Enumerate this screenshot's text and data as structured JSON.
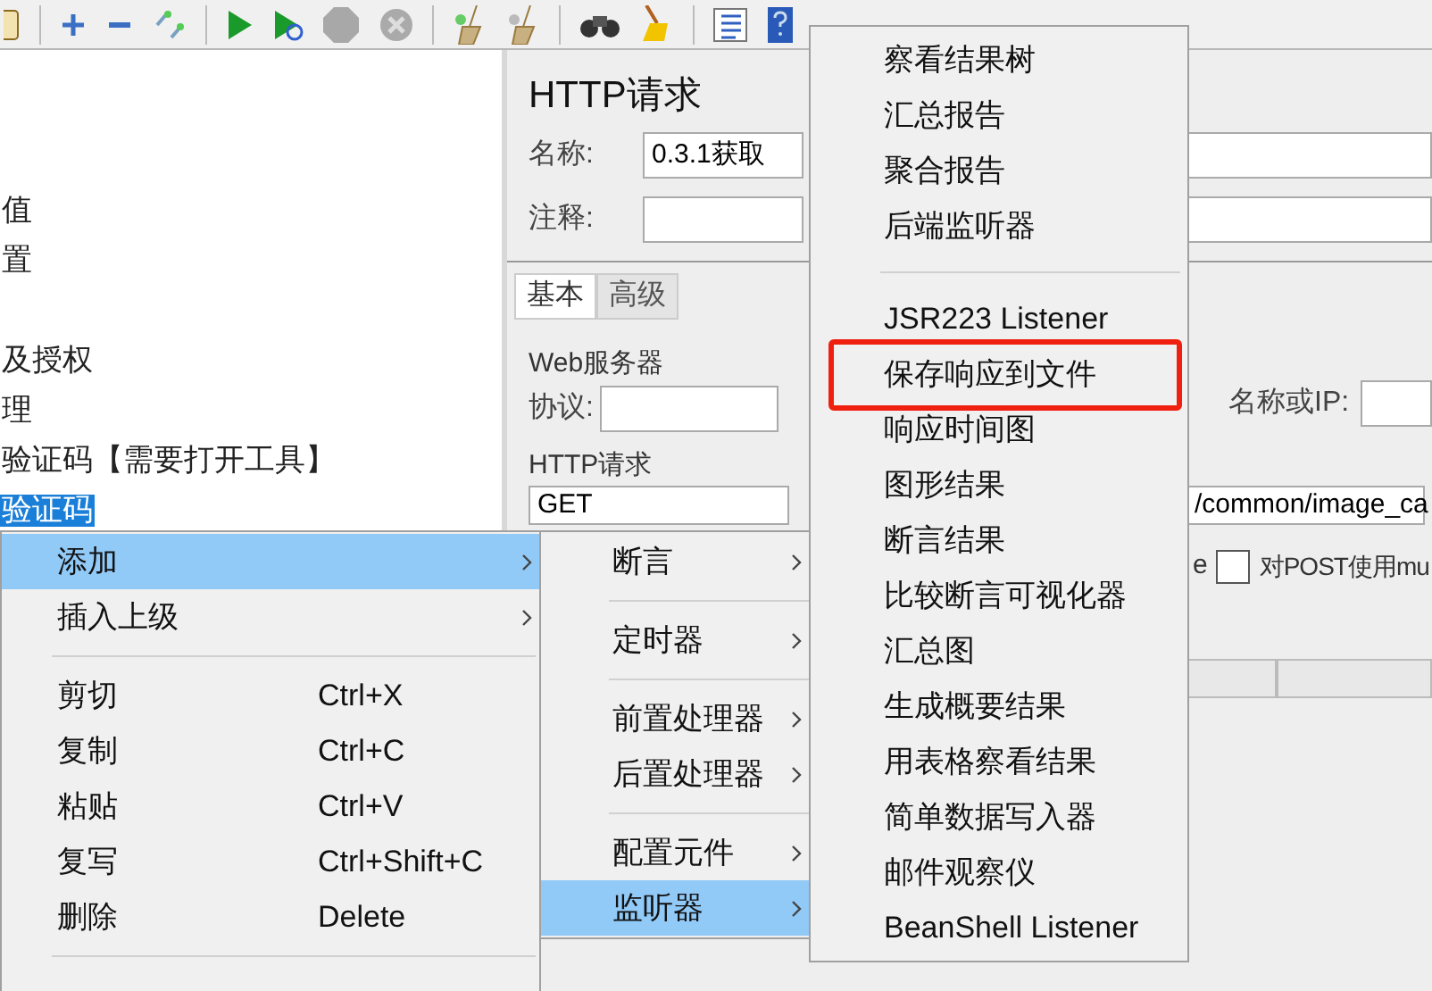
{
  "tree": {
    "items": [
      {
        "label": "值",
        "selected": false
      },
      {
        "label": "置",
        "selected": false
      },
      {
        "label": "及授权",
        "selected": false
      },
      {
        "label": "理",
        "selected": false
      },
      {
        "label": "验证码【需要打开工具】",
        "selected": false
      },
      {
        "label": "验证码",
        "selected": true
      }
    ]
  },
  "editor": {
    "title": "HTTP请求",
    "name_label": "名称:",
    "name_value": "0.3.1获取",
    "comment_label": "注释:",
    "tabs": [
      {
        "label": "基本",
        "selected": true
      },
      {
        "label": "高级",
        "selected": false
      }
    ],
    "web_server": {
      "legend": "Web服务器",
      "protocol_label": "协议:",
      "server_label": "名称或IP:"
    },
    "http_request": {
      "legend": "HTTP请求",
      "method": "GET",
      "path": "/common/image_ca",
      "option_tail": "e",
      "multipart": {
        "label": "对POST使用mu",
        "checked": false
      }
    }
  },
  "context_menu": {
    "items": [
      {
        "kind": "item",
        "label": "添加",
        "submenu": true,
        "selected": true
      },
      {
        "kind": "item",
        "label": "插入上级",
        "submenu": true,
        "selected": false
      },
      {
        "kind": "separator"
      },
      {
        "kind": "item",
        "label": "剪切",
        "shortcut": "Ctrl+X",
        "selected": false
      },
      {
        "kind": "item",
        "label": "复制",
        "shortcut": "Ctrl+C",
        "selected": false
      },
      {
        "kind": "item",
        "label": "粘贴",
        "shortcut": "Ctrl+V",
        "selected": false
      },
      {
        "kind": "item",
        "label": "复写",
        "shortcut": "Ctrl+Shift+C",
        "selected": false
      },
      {
        "kind": "item",
        "label": "删除",
        "shortcut": "Delete",
        "selected": false
      },
      {
        "kind": "separator"
      }
    ]
  },
  "add_menu": {
    "items": [
      {
        "kind": "item",
        "label": "断言",
        "submenu": true,
        "selected": false
      },
      {
        "kind": "separator"
      },
      {
        "kind": "item",
        "label": "定时器",
        "submenu": true,
        "selected": false
      },
      {
        "kind": "separator"
      },
      {
        "kind": "item",
        "label": "前置处理器",
        "submenu": true,
        "selected": false
      },
      {
        "kind": "item",
        "label": "后置处理器",
        "submenu": true,
        "selected": false
      },
      {
        "kind": "separator"
      },
      {
        "kind": "item",
        "label": "配置元件",
        "submenu": true,
        "selected": false
      },
      {
        "kind": "item",
        "label": "监听器",
        "submenu": true,
        "selected": true
      }
    ]
  },
  "listener_menu": {
    "items": [
      {
        "kind": "item",
        "label": "察看结果树",
        "annotated": false
      },
      {
        "kind": "item",
        "label": "汇总报告",
        "annotated": false
      },
      {
        "kind": "item",
        "label": "聚合报告",
        "annotated": false
      },
      {
        "kind": "item",
        "label": "后端监听器",
        "annotated": false
      },
      {
        "kind": "separator"
      },
      {
        "kind": "item",
        "label": "JSR223 Listener",
        "annotated": false
      },
      {
        "kind": "item",
        "label": "保存响应到文件",
        "annotated": true
      },
      {
        "kind": "item",
        "label": "响应时间图",
        "annotated": false
      },
      {
        "kind": "item",
        "label": "图形结果",
        "annotated": false
      },
      {
        "kind": "item",
        "label": "断言结果",
        "annotated": false
      },
      {
        "kind": "item",
        "label": "比较断言可视化器",
        "annotated": false
      },
      {
        "kind": "item",
        "label": "汇总图",
        "annotated": false
      },
      {
        "kind": "item",
        "label": "生成概要结果",
        "annotated": false
      },
      {
        "kind": "item",
        "label": "用表格察看结果",
        "annotated": false
      },
      {
        "kind": "item",
        "label": "简单数据写入器",
        "annotated": false
      },
      {
        "kind": "item",
        "label": "邮件观察仪",
        "annotated": false
      },
      {
        "kind": "item",
        "label": "BeanShell Listener",
        "annotated": false
      }
    ]
  }
}
